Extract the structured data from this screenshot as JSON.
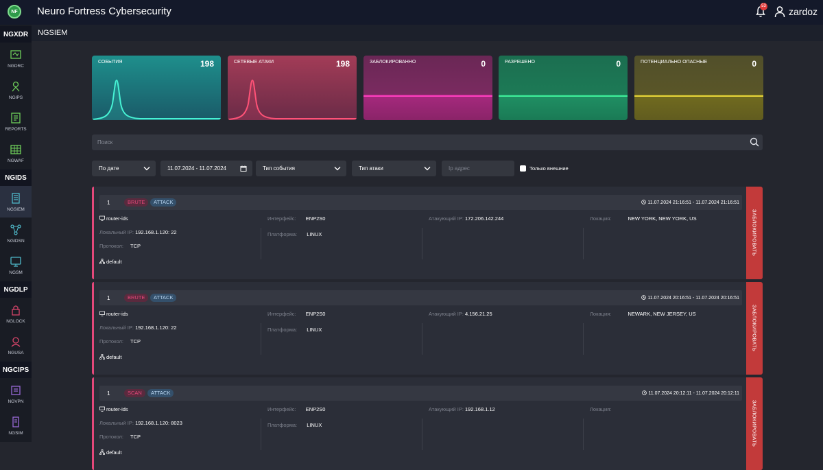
{
  "app": {
    "logo_text": "NF",
    "title": "Neuro Fortress Cybersecurity",
    "notifications": "53",
    "user": "zardoz"
  },
  "sidebar": {
    "groups": [
      "NGXDR",
      "NGIDS",
      "NGDLP",
      "NGCIPS"
    ],
    "items": [
      {
        "label": "NGDRC",
        "icon": "ngdrc-icon",
        "color": "#6fcf5a"
      },
      {
        "label": "NGIPS",
        "icon": "ngips-icon",
        "color": "#6fcf5a"
      },
      {
        "label": "REPORTS",
        "icon": "reports-icon",
        "color": "#6fcf5a"
      },
      {
        "label": "NGWAF",
        "icon": "ngwaf-icon",
        "color": "#6fcf5a"
      },
      {
        "label": "NGSIEM",
        "icon": "ngsiem-icon",
        "color": "#4fb9c9"
      },
      {
        "label": "NGIDSN",
        "icon": "ngidsn-icon",
        "color": "#4fb9c9"
      },
      {
        "label": "NGSM",
        "icon": "ngsm-icon",
        "color": "#4fb9c9"
      },
      {
        "label": "NGLOCK",
        "icon": "nglock-icon",
        "color": "#d8456a"
      },
      {
        "label": "NGUSA",
        "icon": "ngusa-icon",
        "color": "#d8456a"
      },
      {
        "label": "NGVPN",
        "icon": "ngvpn-icon",
        "color": "#9a6ad8"
      },
      {
        "label": "NGSIM",
        "icon": "ngsim-icon",
        "color": "#9a6ad8"
      }
    ]
  },
  "page": {
    "title": "NGSIEM"
  },
  "cards": [
    {
      "label": "СОБЫТИЯ",
      "value": "198",
      "color_top": "#1d8c8c",
      "color_bottom": "#1a5a66",
      "line": "#46f2d4"
    },
    {
      "label": "СЕТЕВЫЕ АТАКИ",
      "value": "198",
      "color_top": "#a13a55",
      "color_bottom": "#6a2a45",
      "line": "#ff5277"
    },
    {
      "label": "ЗАБЛОКИРОВАННО",
      "value": "0",
      "color_top": "#7a2b5f",
      "color_bottom": "#a02a7a",
      "line": "#ff3fc0"
    },
    {
      "label": "РАЗРЕШЕНО",
      "value": "0",
      "color_top": "#1d7a55",
      "color_bottom": "#1e8a5e",
      "line": "#3ff09a"
    },
    {
      "label": "ПОТЕНЦИАЛЬНО ОПАСНЫЕ",
      "value": "0",
      "color_top": "#5a5628",
      "color_bottom": "#6a6520",
      "line": "#e8d63a"
    }
  ],
  "search": {
    "placeholder": "Поиск"
  },
  "filters": {
    "date_mode": "По дате",
    "date_range": "11.07.2024 - 11.07.2024",
    "event_type": "Тип события",
    "attack_type": "Тип атаки",
    "ip_placeholder": "Ip адрес",
    "external_only": "Только внешние"
  },
  "labels": {
    "local_ip": "Локальный IP:",
    "protocol": "Протокол:",
    "interface": "Интерфейс:",
    "platform": "Платформа:",
    "attacker_ip": "Атакующий IP:",
    "location": "Локация:",
    "block": "ЗАБЛОКИРОВАТЬ"
  },
  "events": [
    {
      "count": "1",
      "type": "BRUTE",
      "tag": "ATTACK",
      "time": "11.07.2024 21:16:51 - 11.07.2024 21:16:51",
      "host": "router-ids",
      "local_ip": "192.168.1.120: 22",
      "protocol": "TCP",
      "group": "default",
      "interface": "ENP2S0",
      "platform": "LINUX",
      "attacker_ip": "172.206.142.244",
      "location": "NEW YORK, NEW YORK, US"
    },
    {
      "count": "1",
      "type": "BRUTE",
      "tag": "ATTACK",
      "time": "11.07.2024 20:16:51 - 11.07.2024 20:16:51",
      "host": "router-ids",
      "local_ip": "192.168.1.120: 22",
      "protocol": "TCP",
      "group": "default",
      "interface": "ENP2S0",
      "platform": "LINUX",
      "attacker_ip": "4.156.21.25",
      "location": "NEWARK, NEW JERSEY, US"
    },
    {
      "count": "1",
      "type": "SCAN",
      "tag": "ATTACK",
      "time": "11.07.2024 20:12:11 - 11.07.2024 20:12:11",
      "host": "router-ids",
      "local_ip": "192.168.1.120: 8023",
      "protocol": "TCP",
      "group": "default",
      "interface": "ENP2S0",
      "platform": "LINUX",
      "attacker_ip": "192.168.1.12",
      "location": ""
    }
  ]
}
